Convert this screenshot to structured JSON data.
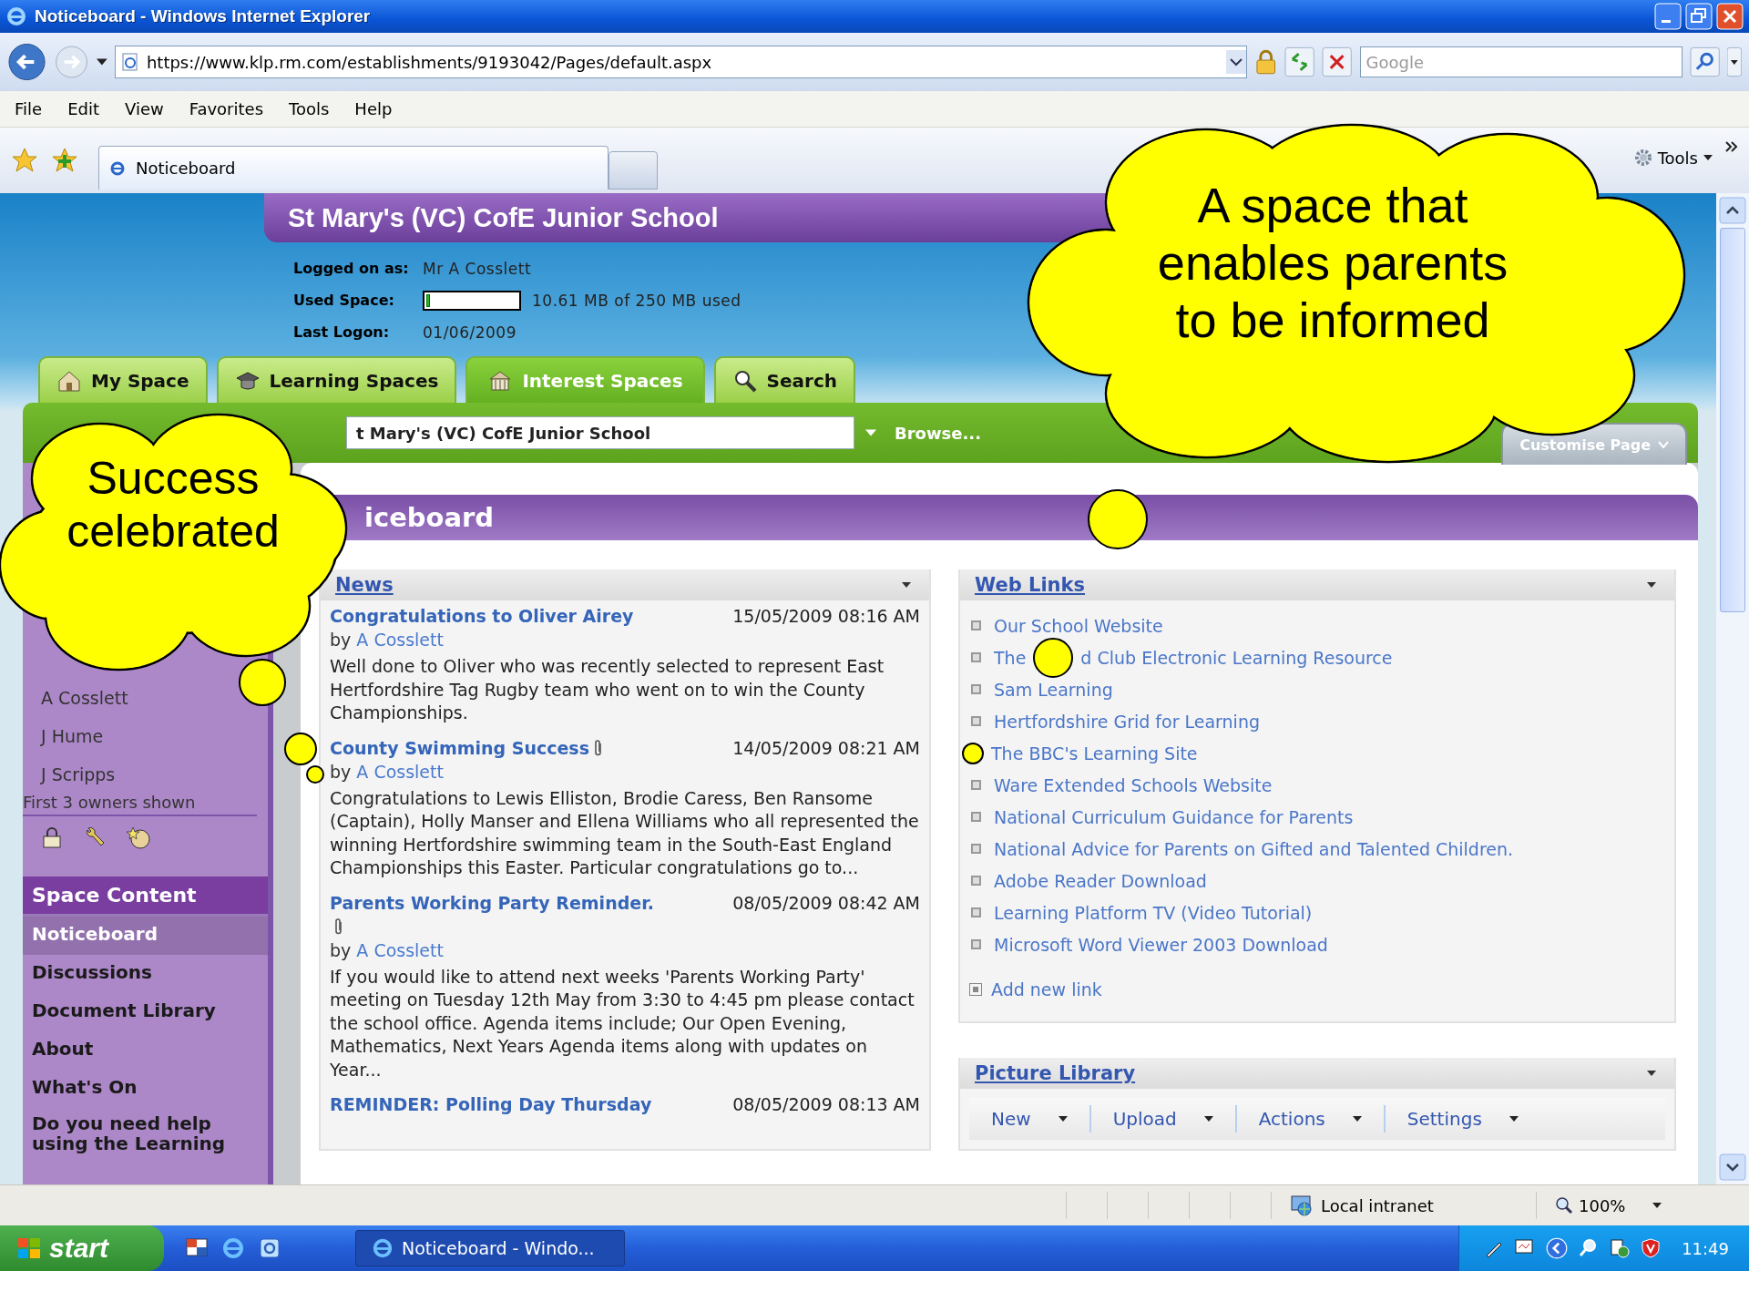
{
  "window": {
    "title": "Noticeboard - Windows Internet Explorer"
  },
  "address_bar": {
    "url": "https://www.klp.rm.com/establishments/9193042/Pages/default.aspx"
  },
  "search_box": {
    "placeholder": "Google"
  },
  "menu": [
    "File",
    "Edit",
    "View",
    "Favorites",
    "Tools",
    "Help"
  ],
  "browser_tab": {
    "label": "Noticeboard"
  },
  "command_bar": {
    "tools": "Tools"
  },
  "site": {
    "school": "St Mary's (VC) CofE Junior School",
    "account": [
      {
        "label": "Logged on as:",
        "kind": "text",
        "value": "Mr A Cosslett"
      },
      {
        "label": "Used Space:",
        "kind": "meter",
        "level": 0.04,
        "value": "10.61 MB of 250 MB used"
      },
      {
        "label": "Last Logon:",
        "kind": "text",
        "value": "01/06/2009"
      }
    ]
  },
  "nav_tabs": [
    {
      "label": "My Space",
      "selected": false
    },
    {
      "label": "Learning Spaces",
      "selected": false
    },
    {
      "label": "Interest Spaces",
      "selected": true
    },
    {
      "label": "Search",
      "selected": false
    }
  ],
  "space_bar": {
    "space": "t Mary's (VC) CofE Junior School",
    "browse": "Browse...",
    "customise": "Customise Page"
  },
  "sidebar": {
    "owners": [
      "A Cosslett",
      "J Hume",
      "J Scripps"
    ],
    "owners_note": "First 3 owners shown",
    "section": "Space Content",
    "items": [
      {
        "label": "Noticeboard",
        "selected": true
      },
      {
        "label": "Discussions",
        "selected": false
      },
      {
        "label": "Document Library",
        "selected": false
      },
      {
        "label": "About",
        "selected": false
      },
      {
        "label": "What's On",
        "selected": false
      },
      {
        "label": "Do you need help using the Learning",
        "selected": false
      }
    ]
  },
  "page_title": "iceboard",
  "news": {
    "title": "News",
    "items": [
      {
        "title": "Congratulations to Oliver Airey",
        "attachment": false,
        "date": "15/05/2009 08:16 AM",
        "by": "by",
        "author": "A Cosslett",
        "body": "Well done to Oliver who was recently selected to represent East Hertfordshire Tag Rugby team who went on to win the County Championships.",
        "gutter_dot": true,
        "title_dot": false,
        "byline_dot": false
      },
      {
        "title": "County Swimming Success",
        "attachment": true,
        "date": "14/05/2009 08:21 AM",
        "by": "by",
        "author": "A Cosslett",
        "body": "Congratulations to Lewis Elliston, Brodie Caress, Ben Ransome (Captain), Holly Manser and Ellena Williams who all represented the winning Hertfordshire swimming team in the South-East England Championships this Easter. Particular congratulations go to...",
        "gutter_dot": false,
        "title_dot": true,
        "byline_dot": true
      },
      {
        "title": "Parents Working Party Reminder.",
        "attachment": true,
        "date": "08/05/2009 08:42 AM",
        "by": "by",
        "author": "A Cosslett",
        "body": "If you would like to attend next weeks 'Parents Working Party' meeting on Tuesday 12th May from 3:30 to 4:45 pm please contact the school office. Agenda items include;  Our Open Evening, Mathematics, Next Years Agenda items along with updates on Year...",
        "gutter_dot": false,
        "title_dot": false,
        "byline_dot": false
      },
      {
        "title": "REMINDER: Polling Day Thursday",
        "attachment": false,
        "date": "08/05/2009 08:13 AM",
        "gutter_dot": false,
        "title_dot": false,
        "byline_dot": false
      }
    ]
  },
  "web_links": {
    "title": "Web Links",
    "marker": true,
    "links": [
      {
        "label": "Our School Website",
        "bullet_dot": false,
        "inline_dot": false
      },
      {
        "label": "The",
        "rest": "d Club Electronic Learning Resource",
        "bullet_dot": false,
        "inline_dot": true
      },
      {
        "label": "Sam Learning",
        "bullet_dot": false,
        "inline_dot": false
      },
      {
        "label": "Hertfordshire Grid for Learning",
        "bullet_dot": false,
        "inline_dot": false
      },
      {
        "label": "The BBC's Learning Site",
        "bullet_dot": true,
        "inline_dot": false
      },
      {
        "label": "Ware Extended Schools Website",
        "bullet_dot": false,
        "inline_dot": false
      },
      {
        "label": "National Curriculum Guidance for Parents",
        "bullet_dot": false,
        "inline_dot": false
      },
      {
        "label": "National Advice for Parents on Gifted and Talented Children.",
        "bullet_dot": false,
        "inline_dot": false
      },
      {
        "label": "Adobe Reader Download",
        "bullet_dot": false,
        "inline_dot": false
      },
      {
        "label": "Learning Platform TV (Video Tutorial)",
        "bullet_dot": false,
        "inline_dot": false
      },
      {
        "label": "Microsoft Word Viewer 2003 Download",
        "bullet_dot": false,
        "inline_dot": false
      }
    ],
    "add": "Add new link"
  },
  "picture_library": {
    "title": "Picture Library",
    "toolbar": [
      "New",
      "Upload",
      "Actions",
      "Settings"
    ]
  },
  "status_bar": {
    "zone": "Local intranet",
    "zoom": "100%"
  },
  "taskbar": {
    "start": "start",
    "task": "Noticeboard - Windo...",
    "clock": "11:49"
  },
  "callouts": [
    {
      "text": "Success celebrated"
    },
    {
      "text": "A space that enables parents to be informed"
    }
  ]
}
